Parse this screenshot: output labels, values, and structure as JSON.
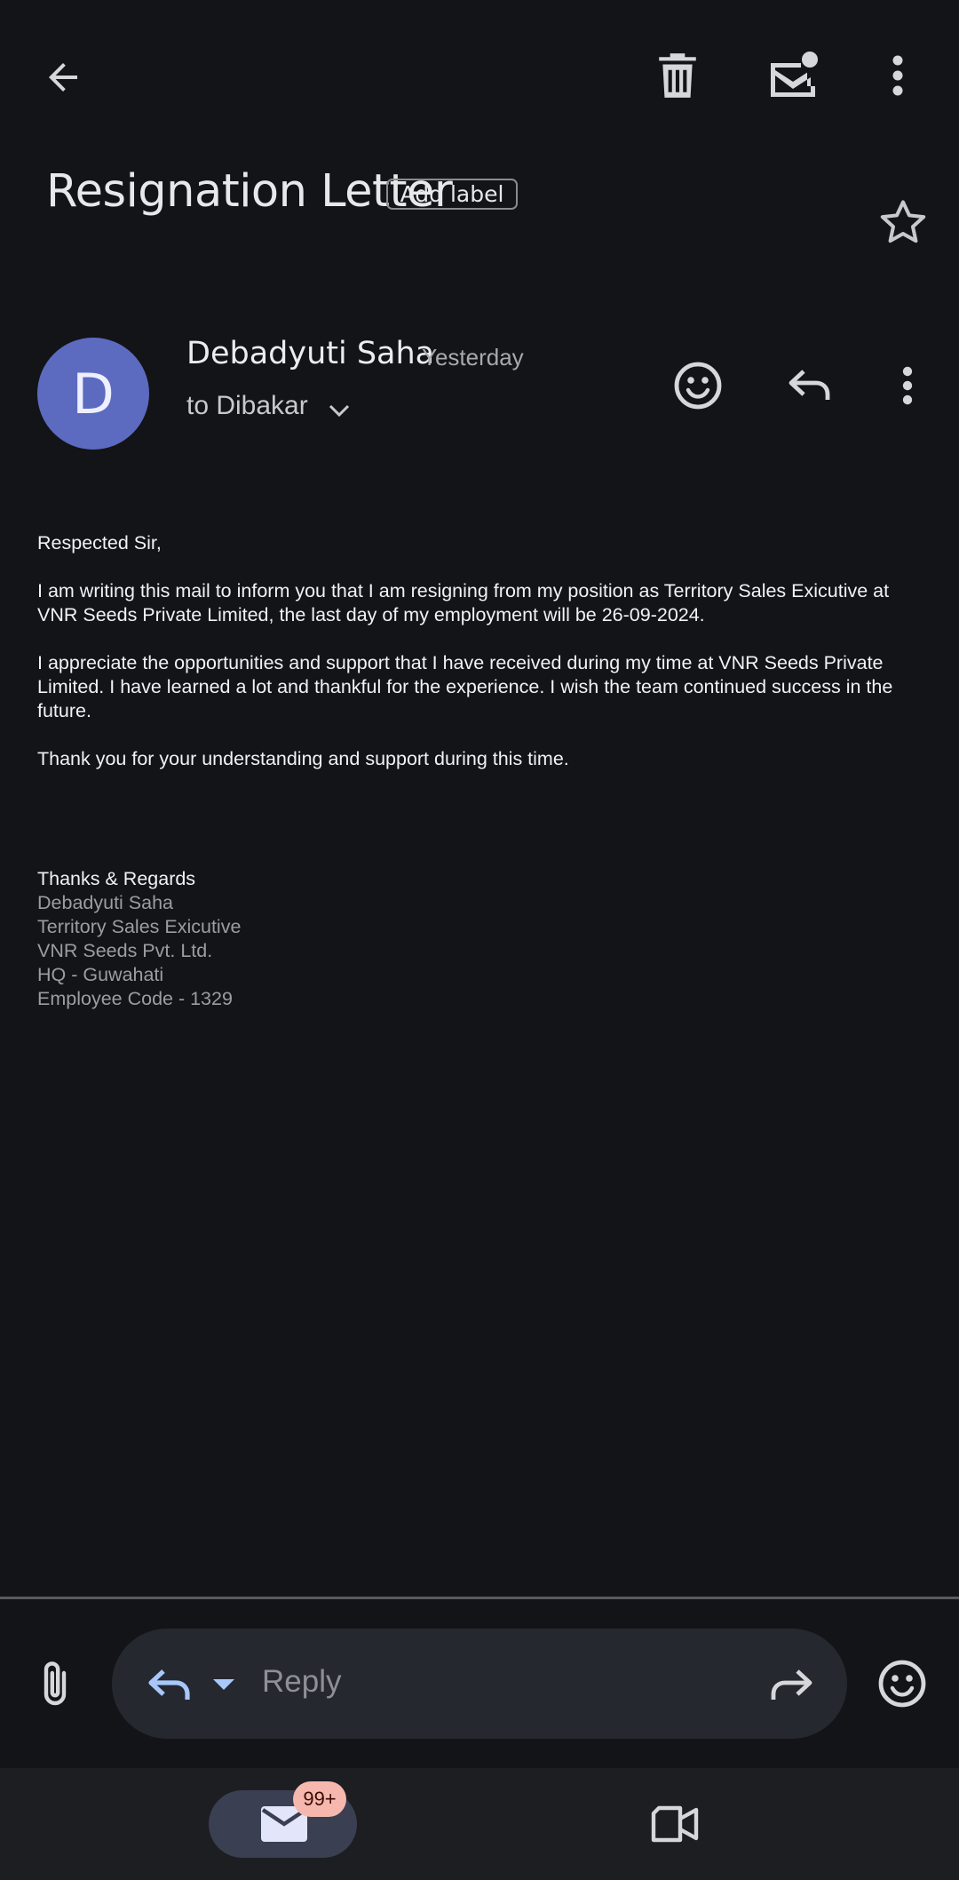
{
  "toolbar": {
    "back_icon": "arrow-left-icon",
    "delete_icon": "trash-icon",
    "mark_unread_icon": "mail-unread-icon",
    "more_icon": "more-vert-icon"
  },
  "email": {
    "subject": "Resignation Letter",
    "add_label": "Add label",
    "sender_initial": "D",
    "sender_name": "Debadyuti Saha",
    "time": "Yesterday",
    "recipient": "to Dibakar",
    "body": [
      "Respected Sir,",
      "I am writing this mail to inform you that I am resigning from my position as Territory Sales Exicutive at VNR Seeds Private Limited, the last day of my employment will be 26-09-2024.",
      "I appreciate the opportunities and support that I have received during my time at VNR Seeds Private Limited. I have learned a lot and thankful for the experience. I wish the team continued success in the future.",
      "Thank you for your understanding and support during this time."
    ],
    "signature": {
      "closing": "Thanks & Regards",
      "name": "Debadyuti Saha",
      "title": "Territory Sales Exicutive",
      "company": "VNR Seeds Pvt. Ltd.",
      "hq": "HQ - Guwahati",
      "employee_code": "Employee Code - 1329"
    }
  },
  "reply_bar": {
    "placeholder": "Reply"
  },
  "bottom_nav": {
    "mail_badge": "99+"
  },
  "colors": {
    "background": "#131418",
    "avatar": "#5c6bc0",
    "accent_blue": "#a8c7fa",
    "badge": "#f6b8ae"
  }
}
